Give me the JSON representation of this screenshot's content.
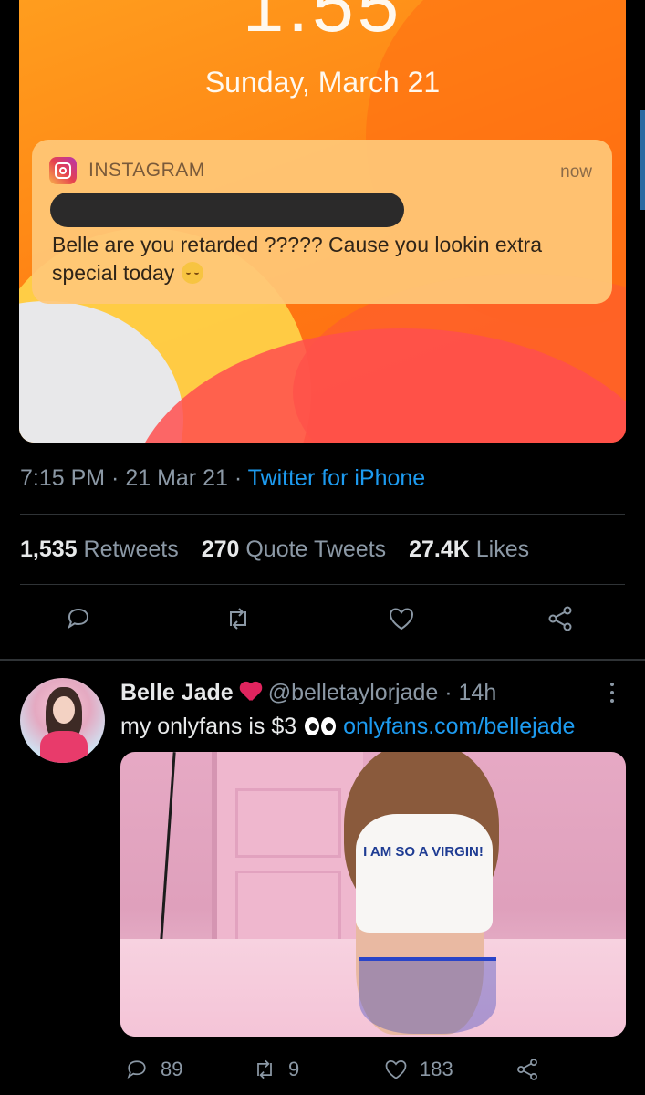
{
  "lockscreen": {
    "time": "1:55",
    "date": "Sunday, March 21",
    "notification": {
      "app_name": "INSTAGRAM",
      "time": "now",
      "body": "Belle are you retarded ????? Cause you lookin extra special today"
    }
  },
  "tweet": {
    "timestamp": "7:15 PM · 21 Mar 21 · ",
    "source": "Twitter for iPhone",
    "stats": {
      "retweets_count": "1,535",
      "retweets_label": "Retweets",
      "quotes_count": "270",
      "quotes_label": "Quote Tweets",
      "likes_count": "27.4K",
      "likes_label": "Likes"
    },
    "action_icons": [
      "reply-icon",
      "retweet-icon",
      "like-icon",
      "share-icon"
    ]
  },
  "reply_tweet": {
    "display_name": "Belle Jade",
    "handle": "@belletaylorjade",
    "time_ago": " · 14h",
    "text": "my onlyfans is $3",
    "link": "onlyfans.com/bellejade",
    "media_shirt_text": "I AM SO A VIRGIN!",
    "reply_count": "89",
    "retweet_count": "9",
    "like_count": "183"
  },
  "colors": {
    "background": "#000000",
    "accent_link": "#1d9bf0",
    "muted_text": "#8b98a5",
    "primary_text": "#e7e9ea"
  }
}
